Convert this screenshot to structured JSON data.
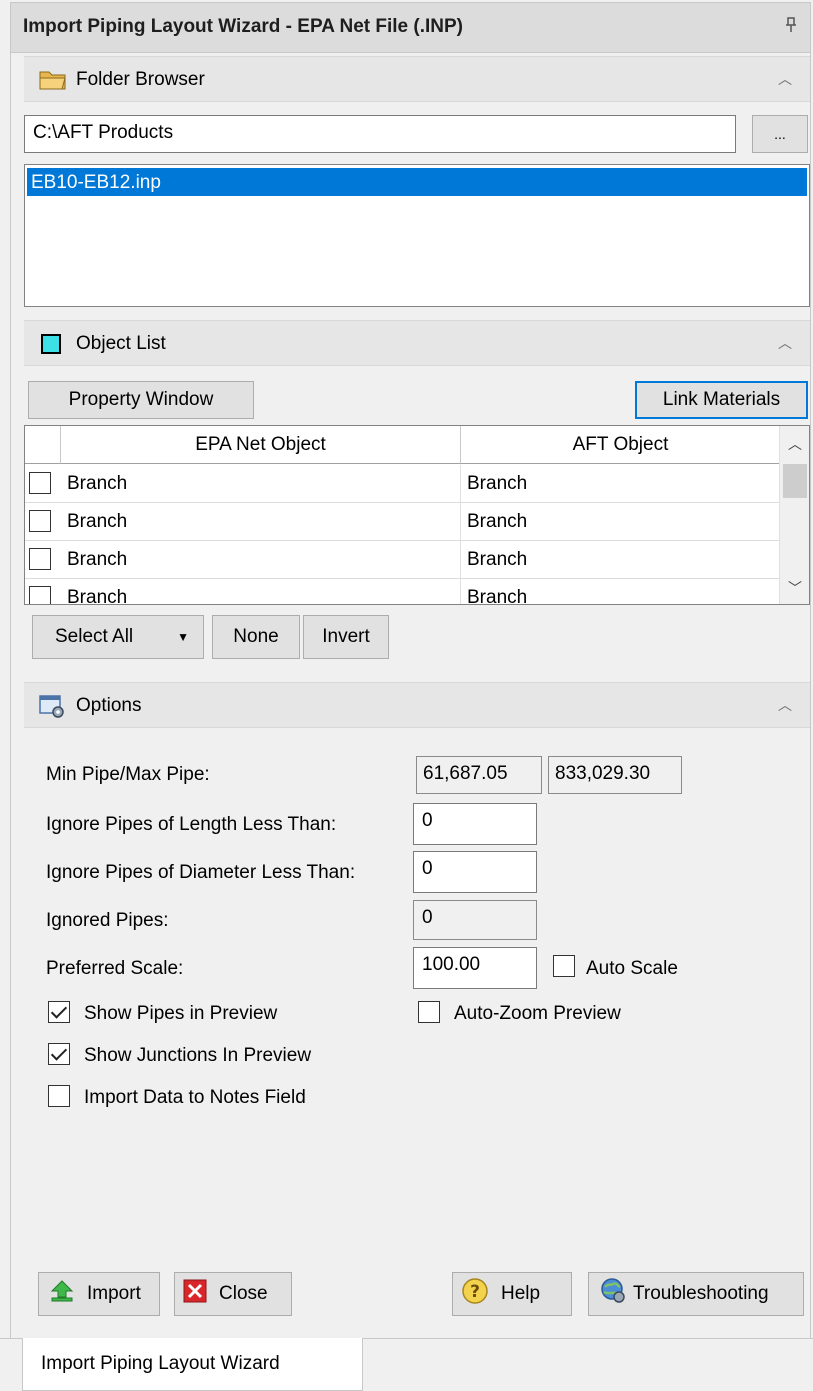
{
  "window": {
    "title": "Import Piping Layout Wizard - EPA Net File (.INP)",
    "pin_glyph": "⊥"
  },
  "folder_browser": {
    "header": "Folder Browser",
    "icon": "folder-icon",
    "path": "C:\\AFT Products",
    "browse_label": "...",
    "files": [
      "EB10-EB12.inp"
    ],
    "selected_file": "EB10-EB12.inp"
  },
  "object_list": {
    "header": "Object List",
    "property_window_label": "Property Window",
    "link_materials_label": "Link Materials",
    "columns": [
      "EPA Net Object",
      "AFT Object"
    ],
    "rows": [
      {
        "epa": "Branch",
        "aft": "Branch",
        "checked": false
      },
      {
        "epa": "Branch",
        "aft": "Branch",
        "checked": false
      },
      {
        "epa": "Branch",
        "aft": "Branch",
        "checked": false
      },
      {
        "epa": "Branch",
        "aft": "Branch",
        "checked": false
      }
    ],
    "select_all_label": "Select All",
    "none_label": "None",
    "invert_label": "Invert"
  },
  "options": {
    "header": "Options",
    "min_max_label": "Min Pipe/Max Pipe:",
    "min_pipe": "61,687.05",
    "max_pipe": "833,029.30",
    "ignore_length_label": "Ignore Pipes of Length Less Than:",
    "ignore_length_value": "0",
    "ignore_diameter_label": "Ignore Pipes of Diameter Less Than:",
    "ignore_diameter_value": "0",
    "ignored_pipes_label": "Ignored Pipes:",
    "ignored_pipes_value": "0",
    "preferred_scale_label": "Preferred Scale:",
    "preferred_scale_value": "100.00",
    "auto_scale_label": "Auto Scale",
    "auto_scale_checked": false,
    "show_pipes_label": "Show Pipes in Preview",
    "show_pipes_checked": true,
    "auto_zoom_label": "Auto-Zoom Preview",
    "auto_zoom_checked": false,
    "show_junctions_label": "Show Junctions In Preview",
    "show_junctions_checked": true,
    "import_notes_label": "Import Data to Notes Field",
    "import_notes_checked": false
  },
  "footer": {
    "import_label": "Import",
    "close_label": "Close",
    "help_label": "Help",
    "troubleshooting_label": "Troubleshooting"
  },
  "tabs": {
    "active": "Import Piping Layout Wizard"
  },
  "colors": {
    "selection": "#0078d7",
    "panel_bg": "#f0f0f0",
    "header_bg": "#e6e6e6"
  }
}
